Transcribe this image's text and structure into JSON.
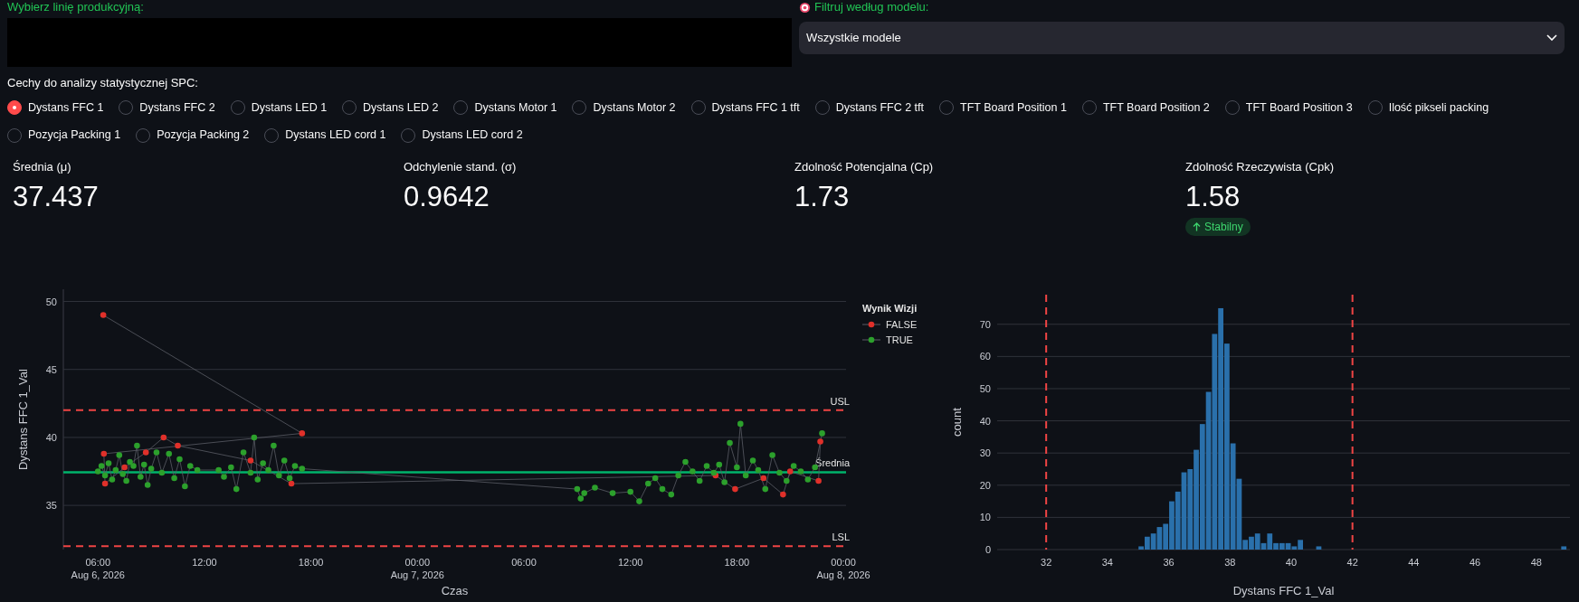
{
  "line_select": {
    "label": "Wybierz linię produkcyjną:"
  },
  "model_filter": {
    "label": "Filtruj według modelu:",
    "value": "Wszystkie modele"
  },
  "features": {
    "label": "Cechy do analizy statystycznej SPC:",
    "options": [
      {
        "label": "Dystans FFC 1",
        "selected": true
      },
      {
        "label": "Dystans FFC 2",
        "selected": false
      },
      {
        "label": "Dystans LED 1",
        "selected": false
      },
      {
        "label": "Dystans LED 2",
        "selected": false
      },
      {
        "label": "Dystans Motor 1",
        "selected": false
      },
      {
        "label": "Dystans Motor 2",
        "selected": false
      },
      {
        "label": "Dystans FFC 1 tft",
        "selected": false
      },
      {
        "label": "Dystans FFC 2 tft",
        "selected": false
      },
      {
        "label": "TFT Board Position 1",
        "selected": false
      },
      {
        "label": "TFT Board Position 2",
        "selected": false
      },
      {
        "label": "TFT Board Position 3",
        "selected": false
      },
      {
        "label": "Ilość pikseli packing",
        "selected": false
      },
      {
        "label": "Pozycja Packing 1",
        "selected": false
      },
      {
        "label": "Pozycja Packing 2",
        "selected": false
      },
      {
        "label": "Dystans LED cord 1",
        "selected": false
      },
      {
        "label": "Dystans LED cord 2",
        "selected": false
      }
    ]
  },
  "metrics": [
    {
      "label": "Średnia (μ)",
      "value": "37.437"
    },
    {
      "label": "Odchylenie stand. (σ)",
      "value": "0.9642"
    },
    {
      "label": "Zdolność Potencjalna (Cp)",
      "value": "1.73"
    },
    {
      "label": "Zdolność Rzeczywista (Cpk)",
      "value": "1.58",
      "delta": {
        "text": "Stabilny"
      }
    }
  ],
  "control_chart": {
    "chart_data": {
      "type": "line",
      "xlabel": "Czas",
      "ylabel": "Dystans FFC 1_Val",
      "grid": true,
      "legend": {
        "title": "Wynik Wizji"
      },
      "xlim": [
        "2026-08-06 04:03",
        "2026-08-08 00:09"
      ],
      "ylim": [
        31.75,
        50.9
      ],
      "xticks": [
        {
          "value": "2026-08-06 06:00",
          "label": "06:00\nAug 6, 2026"
        },
        {
          "value": "2026-08-06 12:00",
          "label": "12:00"
        },
        {
          "value": "2026-08-06 18:00",
          "label": "18:00"
        },
        {
          "value": "2026-08-07 00:00",
          "label": "00:00\nAug 7, 2026"
        },
        {
          "value": "2026-08-07 06:00",
          "label": "06:00"
        },
        {
          "value": "2026-08-07 12:00",
          "label": "12:00"
        },
        {
          "value": "2026-08-07 18:00",
          "label": "18:00"
        },
        {
          "value": "2026-08-08 00:00",
          "label": "00:00\nAug 8, 2026"
        }
      ],
      "yticks": [
        35,
        40,
        45,
        50
      ],
      "series": [
        {
          "name": "FALSE",
          "color": "#e0302a",
          "marker": "circle",
          "x": [
            "2026-08-06 06:18",
            "2026-08-06 17:30",
            "2026-08-06 06:20",
            "2026-08-06 06:24",
            "2026-08-06 07:30",
            "2026-08-06 08:42",
            "2026-08-06 09:42",
            "2026-08-06 10:30",
            "2026-08-06 14:36",
            "2026-08-06 16:54",
            "2026-08-07 16:48",
            "2026-08-07 17:54",
            "2026-08-07 19:30",
            "2026-08-07 20:36",
            "2026-08-07 21:00",
            "2026-08-07 22:36",
            "2026-08-07 22:42"
          ],
          "values": [
            49.0,
            40.3,
            38.8,
            36.6,
            37.8,
            38.9,
            40.0,
            39.4,
            38.3,
            36.6,
            37.2,
            36.2,
            37.0,
            35.8,
            37.5,
            36.8,
            39.7
          ]
        },
        {
          "name": "TRUE",
          "color": "#2ca02c",
          "marker": "circle",
          "x": [
            "2026-08-06 06:00",
            "2026-08-06 06:12",
            "2026-08-06 06:24",
            "2026-08-06 06:36",
            "2026-08-06 06:48",
            "2026-08-06 07:00",
            "2026-08-06 07:12",
            "2026-08-06 07:24",
            "2026-08-06 07:36",
            "2026-08-06 07:48",
            "2026-08-06 08:00",
            "2026-08-06 08:12",
            "2026-08-06 08:24",
            "2026-08-06 08:36",
            "2026-08-06 08:48",
            "2026-08-06 09:00",
            "2026-08-06 09:18",
            "2026-08-06 09:36",
            "2026-08-06 10:00",
            "2026-08-06 10:18",
            "2026-08-06 10:36",
            "2026-08-06 10:54",
            "2026-08-06 11:12",
            "2026-08-06 11:36",
            "2026-08-06 12:48",
            "2026-08-06 13:06",
            "2026-08-06 13:30",
            "2026-08-06 13:48",
            "2026-08-06 14:12",
            "2026-08-06 14:36",
            "2026-08-06 14:48",
            "2026-08-06 15:00",
            "2026-08-06 15:18",
            "2026-08-06 15:36",
            "2026-08-06 15:54",
            "2026-08-06 16:12",
            "2026-08-06 16:30",
            "2026-08-06 16:48",
            "2026-08-06 17:06",
            "2026-08-06 17:30",
            "2026-08-07 09:00",
            "2026-08-07 09:12",
            "2026-08-07 09:24",
            "2026-08-07 10:00",
            "2026-08-07 11:00",
            "2026-08-07 12:00",
            "2026-08-07 12:30",
            "2026-08-07 13:00",
            "2026-08-07 13:24",
            "2026-08-07 13:48",
            "2026-08-07 14:18",
            "2026-08-07 14:42",
            "2026-08-07 15:06",
            "2026-08-07 15:30",
            "2026-08-07 15:54",
            "2026-08-07 16:18",
            "2026-08-07 16:42",
            "2026-08-07 17:00",
            "2026-08-07 17:18",
            "2026-08-07 17:36",
            "2026-08-07 18:00",
            "2026-08-07 18:12",
            "2026-08-07 18:30",
            "2026-08-07 18:54",
            "2026-08-07 19:12",
            "2026-08-07 19:36",
            "2026-08-07 20:00",
            "2026-08-07 20:24",
            "2026-08-07 20:48",
            "2026-08-07 21:12",
            "2026-08-07 21:36",
            "2026-08-07 22:00",
            "2026-08-07 22:24",
            "2026-08-07 22:48"
          ],
          "values": [
            37.5,
            37.9,
            37.2,
            38.1,
            36.9,
            37.6,
            38.7,
            37.3,
            36.8,
            38.2,
            37.9,
            39.4,
            37.1,
            38.0,
            36.5,
            37.7,
            38.9,
            37.4,
            38.8,
            37.0,
            38.4,
            36.4,
            37.9,
            37.6,
            37.6,
            37.1,
            37.8,
            36.2,
            38.9,
            37.4,
            40.0,
            36.9,
            38.1,
            37.6,
            39.4,
            37.2,
            38.3,
            37.0,
            37.9,
            37.7,
            36.2,
            35.5,
            35.9,
            36.3,
            35.9,
            36.0,
            35.3,
            36.6,
            37.0,
            36.2,
            35.8,
            37.2,
            38.2,
            37.5,
            36.8,
            37.9,
            37.4,
            38.0,
            36.7,
            39.6,
            37.8,
            41.0,
            37.2,
            38.3,
            37.6,
            36.2,
            38.7,
            37.4,
            36.8,
            37.9,
            37.5,
            36.9,
            37.8,
            40.3
          ]
        }
      ],
      "ref_lines": [
        {
          "axis": "y",
          "value": 42,
          "label": "USL",
          "color": "#ef4444"
        },
        {
          "axis": "y",
          "value": 37.437,
          "label": "Średnia",
          "color": "#00b36b"
        },
        {
          "axis": "y",
          "value": 32,
          "label": "LSL",
          "color": "#ef4444"
        }
      ]
    }
  },
  "histogram": {
    "chart_data": {
      "type": "bar",
      "xlabel": "Dystans FFC 1_Val",
      "ylabel": "count",
      "grid": true,
      "xlim": [
        30.4,
        49.1
      ],
      "ylim": [
        0,
        79.2
      ],
      "xticks": [
        32,
        34,
        36,
        38,
        40,
        42,
        44,
        46,
        48
      ],
      "yticks": [
        0,
        10,
        20,
        30,
        40,
        50,
        60,
        70
      ],
      "x": [
        35.1,
        35.3,
        35.5,
        35.7,
        35.9,
        36.1,
        36.3,
        36.5,
        36.7,
        36.9,
        37.1,
        37.3,
        37.5,
        37.7,
        37.9,
        38.1,
        38.3,
        38.5,
        38.7,
        38.9,
        39.1,
        39.3,
        39.5,
        39.7,
        39.9,
        40.1,
        40.3,
        40.9,
        48.9
      ],
      "values": [
        1,
        4,
        5,
        7,
        8,
        15,
        18,
        24,
        25,
        31,
        39,
        49,
        67,
        75,
        64,
        33,
        22,
        3,
        4,
        5,
        2,
        5,
        2,
        2,
        2,
        1,
        3,
        1,
        1
      ],
      "ref_lines": [
        {
          "axis": "x",
          "value": 32,
          "color": "#ef4444"
        },
        {
          "axis": "x",
          "value": 42,
          "color": "#ef4444"
        }
      ]
    }
  }
}
